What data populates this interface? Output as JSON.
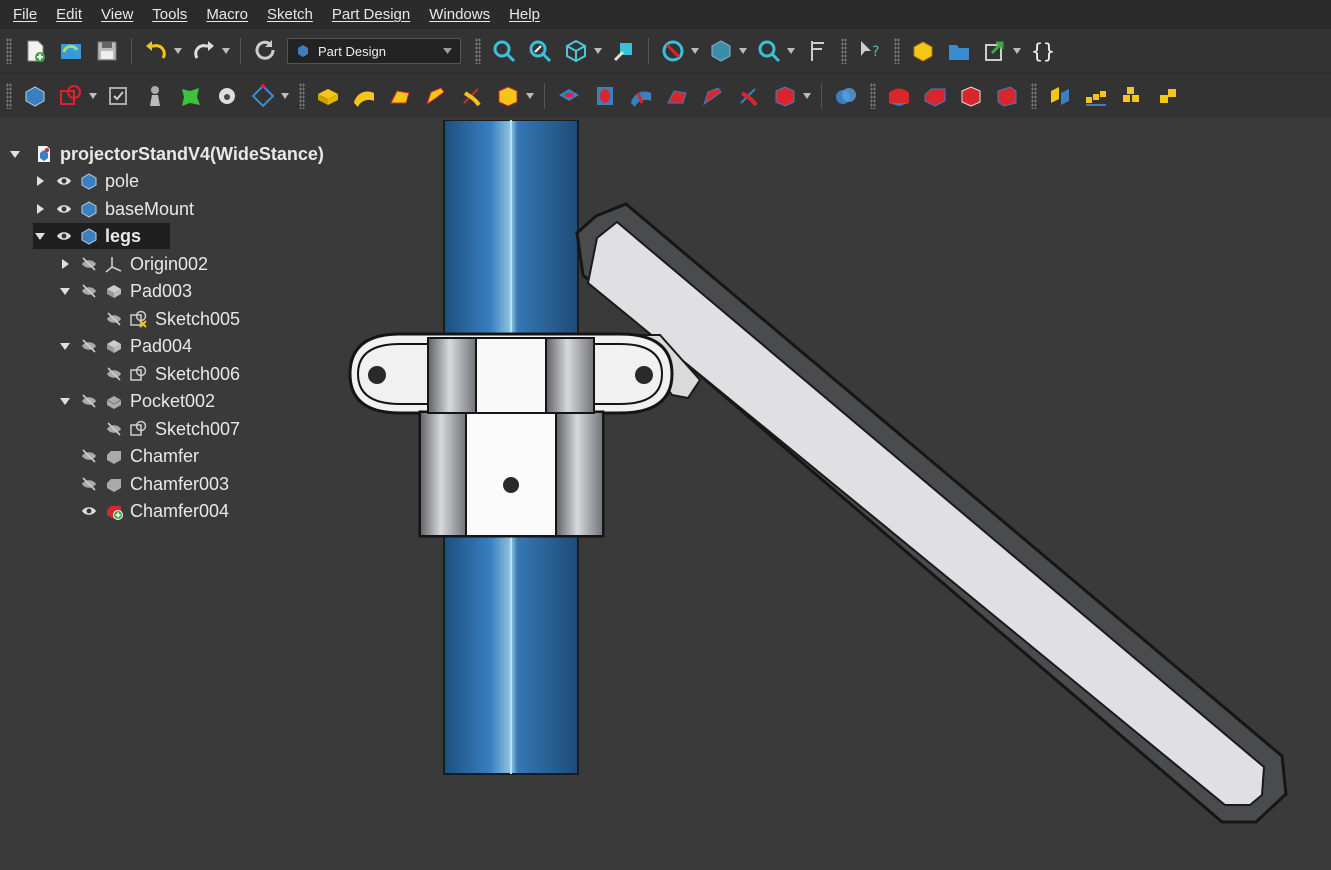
{
  "menu": [
    "File",
    "Edit",
    "View",
    "Tools",
    "Macro",
    "Sketch",
    "Part Design",
    "Windows",
    "Help"
  ],
  "workbench": {
    "label": "Part Design"
  },
  "braces_label": "{}",
  "colors": {
    "background": "#3a3a3a",
    "accent_blue": "#3a7fc0",
    "icon_yellow": "#f5c518",
    "icon_red": "#d8262c",
    "selection": "#1f1f1f"
  },
  "tree": {
    "root": "projectorStandV4(WideStance)",
    "items": [
      {
        "label": "pole",
        "icon": "body-icon"
      },
      {
        "label": "baseMount",
        "icon": "body-icon"
      },
      {
        "label": "legs",
        "icon": "body-icon"
      },
      {
        "label": "Origin002",
        "icon": "origin-icon"
      },
      {
        "label": "Pad003",
        "icon": "pad-icon"
      },
      {
        "label": "Sketch005",
        "icon": "sketch-error-icon"
      },
      {
        "label": "Pad004",
        "icon": "pad-icon"
      },
      {
        "label": "Sketch006",
        "icon": "sketch-icon"
      },
      {
        "label": "Pocket002",
        "icon": "pocket-icon"
      },
      {
        "label": "Sketch007",
        "icon": "sketch-icon"
      },
      {
        "label": "Chamfer",
        "icon": "chamfer-icon"
      },
      {
        "label": "Chamfer003",
        "icon": "chamfer-icon"
      },
      {
        "label": "Chamfer004",
        "icon": "chamfer-tip-icon"
      }
    ]
  }
}
